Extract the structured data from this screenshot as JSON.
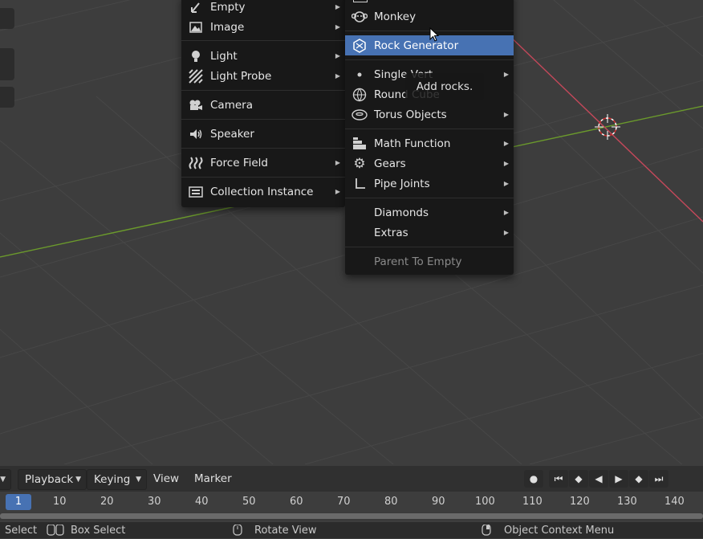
{
  "add_menu": {
    "items": [
      {
        "label": "Empty",
        "icon": "empty-icon",
        "submenu": true
      },
      {
        "label": "Image",
        "icon": "image-icon",
        "submenu": true
      },
      {
        "label": "Light",
        "icon": "light-icon",
        "submenu": true
      },
      {
        "label": "Light Probe",
        "icon": "light-probe-icon",
        "submenu": true
      },
      {
        "label": "Camera",
        "icon": "camera-icon",
        "submenu": false
      },
      {
        "label": "Speaker",
        "icon": "speaker-icon",
        "submenu": false
      },
      {
        "label": "Force Field",
        "icon": "force-field-icon",
        "submenu": true
      },
      {
        "label": "Collection Instance",
        "icon": "collection-instance-icon",
        "submenu": true
      }
    ]
  },
  "mesh_menu": {
    "items": [
      {
        "label": "Monkey",
        "icon": "monkey-icon",
        "submenu": false
      },
      {
        "label": "Rock Generator",
        "icon": "rock-icon",
        "submenu": false,
        "highlighted": true
      },
      {
        "label": "Single Vert",
        "icon": "vertex-icon",
        "submenu": true
      },
      {
        "label": "Round Cube",
        "icon": "round-cube-icon",
        "submenu": false
      },
      {
        "label": "Torus Objects",
        "icon": "torus-icon",
        "submenu": true
      },
      {
        "label": "Math Function",
        "icon": "math-function-icon",
        "submenu": true
      },
      {
        "label": "Gears",
        "icon": "gear-icon",
        "submenu": true
      },
      {
        "label": "Pipe Joints",
        "icon": "pipe-joint-icon",
        "submenu": true
      },
      {
        "label": "Diamonds",
        "icon": "",
        "submenu": true
      },
      {
        "label": "Extras",
        "icon": "",
        "submenu": true
      },
      {
        "label": "Parent To Empty",
        "icon": "",
        "submenu": false,
        "disabled": true
      }
    ]
  },
  "tooltip": {
    "text": "Add rocks."
  },
  "timeline": {
    "playback_label": "Playback",
    "keying_label": "Keying",
    "view_label": "View",
    "marker_label": "Marker",
    "current_frame": "1",
    "ticks": [
      "10",
      "20",
      "30",
      "40",
      "50",
      "60",
      "70",
      "80",
      "90",
      "100",
      "110",
      "120",
      "130",
      "140"
    ]
  },
  "status_bar": {
    "select": "Select",
    "box_select": "Box Select",
    "rotate_view": "Rotate View",
    "context_menu": "Object Context Menu"
  },
  "colors": {
    "viewport_bg": "#3d3d3d",
    "grid_line": "#474747",
    "x_axis": "#c4485a",
    "y_axis": "#6b9a2c",
    "highlight": "#4772b3",
    "menu_bg": "#181818"
  }
}
